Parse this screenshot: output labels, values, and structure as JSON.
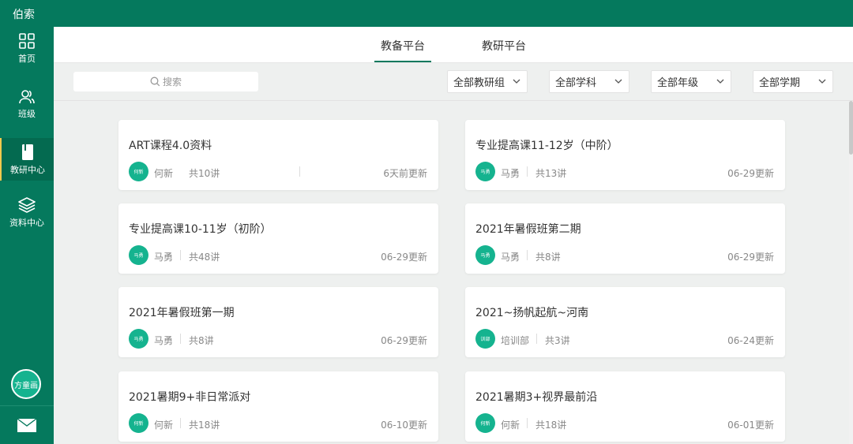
{
  "app": {
    "brand": "伯索"
  },
  "sidebar": {
    "items": [
      {
        "label": "首页"
      },
      {
        "label": "班级"
      },
      {
        "label": "教研中心"
      },
      {
        "label": "资料中心"
      }
    ],
    "user_avatar": "方童画"
  },
  "tabs": [
    {
      "label": "教备平台"
    },
    {
      "label": "教研平台"
    }
  ],
  "filters": {
    "search_placeholder": "搜索",
    "dropdowns": [
      "全部教研组",
      "全部学科",
      "全部年级",
      "全部学期"
    ]
  },
  "cards": [
    {
      "title": "ART课程4.0资料",
      "avatar": "何新",
      "author": "何新",
      "lessons": "共10讲",
      "updated": "6天前更新"
    },
    {
      "title": "专业提高课11-12岁（中阶）",
      "avatar": "马勇",
      "author": "马勇",
      "lessons": "共13讲",
      "updated": "06-29更新"
    },
    {
      "title": "专业提高课10-11岁（初阶）",
      "avatar": "马勇",
      "author": "马勇",
      "lessons": "共48讲",
      "updated": "06-29更新"
    },
    {
      "title": "2021年暑假班第二期",
      "avatar": "马勇",
      "author": "马勇",
      "lessons": "共8讲",
      "updated": "06-29更新"
    },
    {
      "title": "2021年暑假班第一期",
      "avatar": "马勇",
      "author": "马勇",
      "lessons": "共8讲",
      "updated": "06-29更新"
    },
    {
      "title": "2021~扬帆起航~河南",
      "avatar": "训部",
      "author": "培训部",
      "lessons": "共3讲",
      "updated": "06-24更新"
    },
    {
      "title": "2021暑期9+非日常派对",
      "avatar": "何新",
      "author": "何新",
      "lessons": "共18讲",
      "updated": "06-10更新"
    },
    {
      "title": "2021暑期3+视界最前沿",
      "avatar": "何新",
      "author": "何新",
      "lessons": "共18讲",
      "updated": "06-01更新"
    }
  ],
  "colors": {
    "primary": "#05795d",
    "accent": "#15b38f",
    "active_marker": "#f2c94c"
  }
}
